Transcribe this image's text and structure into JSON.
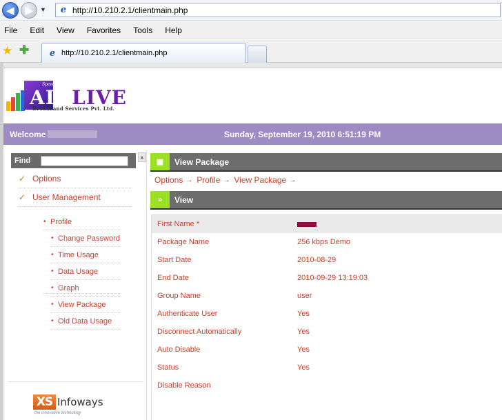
{
  "browser": {
    "address_url": "http://10.210.2.1/clientmain.php",
    "menu": [
      "File",
      "Edit",
      "View",
      "Favorites",
      "Tools",
      "Help"
    ],
    "tab_title": "http://10.210.2.1/clientmain.php"
  },
  "header": {
    "logo": {
      "speed_text": "Speed",
      "brand_first": "AIR",
      "brand_rest": "LIVE",
      "subtitle": "Broadband Services Pvt. Ltd."
    },
    "welcome_label": "Welcome",
    "datetime": "Sunday, September 19, 2010 6:51:19 PM"
  },
  "sidebar": {
    "find_label": "Find",
    "find_value": "",
    "main_items": [
      {
        "label": "Options"
      },
      {
        "label": "User Management"
      }
    ],
    "sub_items": [
      {
        "label": "Profile"
      },
      {
        "label": "Change Password"
      },
      {
        "label": "Time Usage"
      },
      {
        "label": "Data Usage"
      },
      {
        "label": "Graph"
      },
      {
        "label": "View Package"
      },
      {
        "label": "Old Data Usage"
      }
    ],
    "footer_logo": {
      "mark": "XS",
      "name": "Infoways",
      "tagline": "the innovative technology"
    }
  },
  "main": {
    "section_title": "View Package",
    "breadcrumb": [
      "Options",
      "Profile",
      "View Package"
    ],
    "breadcrumb_separator": "→",
    "view_title": "View",
    "rows": [
      {
        "label": "First Name *",
        "value": ""
      },
      {
        "label": "Package Name",
        "value": "256 kbps Demo"
      },
      {
        "label": "Start Date",
        "value": "2010-08-29"
      },
      {
        "label": "End Date",
        "value": "2010-09-29 13:19:03"
      },
      {
        "label": "Group Name",
        "value": "user"
      },
      {
        "label": "Authenticate User",
        "value": "Yes"
      },
      {
        "label": "Disconnect Automatically",
        "value": "Yes"
      },
      {
        "label": "Auto Disable",
        "value": "Yes"
      },
      {
        "label": "Status",
        "value": "Yes"
      },
      {
        "label": "Disable Reason",
        "value": ""
      }
    ]
  }
}
